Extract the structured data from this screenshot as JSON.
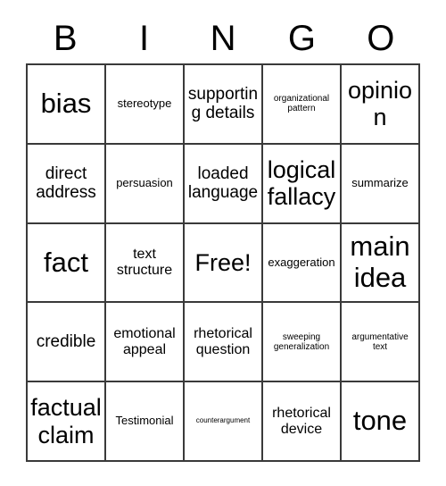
{
  "card": {
    "header_letters": [
      "B",
      "I",
      "N",
      "G",
      "O"
    ],
    "rows": [
      [
        {
          "text": "bias",
          "size": "sz-xxl"
        },
        {
          "text": "stereotype",
          "size": "sz-s"
        },
        {
          "text": "supporting details",
          "size": "sz-l"
        },
        {
          "text": "organizational pattern",
          "size": "sz-xs"
        },
        {
          "text": "opinion",
          "size": "sz-xl"
        }
      ],
      [
        {
          "text": "direct address",
          "size": "sz-l"
        },
        {
          "text": "persuasion",
          "size": "sz-s"
        },
        {
          "text": "loaded language",
          "size": "sz-l"
        },
        {
          "text": "logical fallacy",
          "size": "sz-xl"
        },
        {
          "text": "summarize",
          "size": "sz-s"
        }
      ],
      [
        {
          "text": "fact",
          "size": "sz-xxl"
        },
        {
          "text": "text structure",
          "size": "sz-m"
        },
        {
          "text": "Free!",
          "size": "sz-xl"
        },
        {
          "text": "exaggeration",
          "size": "sz-s"
        },
        {
          "text": "main idea",
          "size": "sz-xxl"
        }
      ],
      [
        {
          "text": "credible",
          "size": "sz-l"
        },
        {
          "text": "emotional appeal",
          "size": "sz-m"
        },
        {
          "text": "rhetorical question",
          "size": "sz-m"
        },
        {
          "text": "sweeping generalization",
          "size": "sz-xs"
        },
        {
          "text": "argumentative text",
          "size": "sz-xs"
        }
      ],
      [
        {
          "text": "factual claim",
          "size": "sz-xl"
        },
        {
          "text": "Testimonial",
          "size": "sz-s"
        },
        {
          "text": "counterargument",
          "size": "sz-xxs"
        },
        {
          "text": "rhetorical device",
          "size": "sz-m"
        },
        {
          "text": "tone",
          "size": "sz-xxl"
        }
      ]
    ]
  },
  "colors": {
    "background": "#ffffff",
    "text": "#000000",
    "grid_line": "#3a3a3a"
  }
}
